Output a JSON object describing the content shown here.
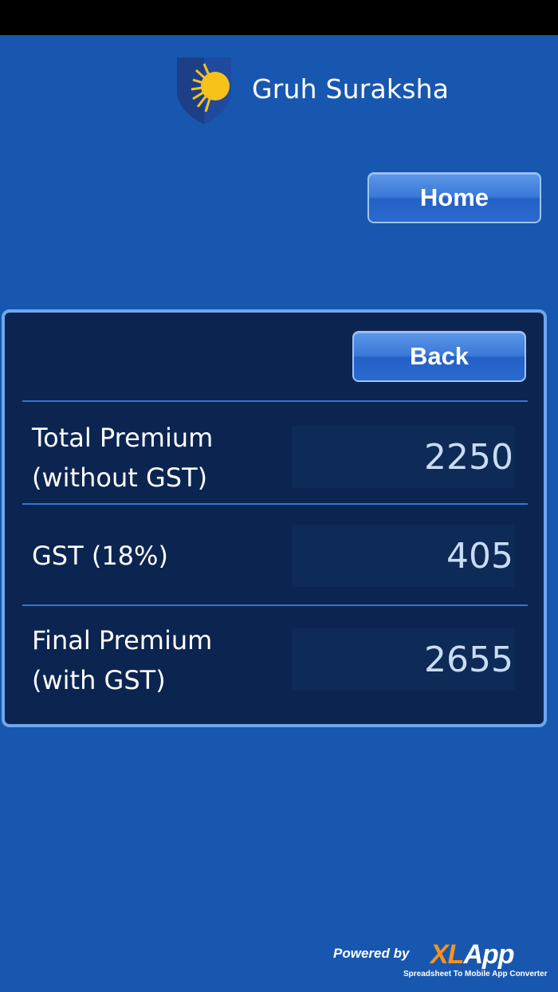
{
  "header": {
    "title": "Gruh Suraksha"
  },
  "nav": {
    "home_label": "Home",
    "back_label": "Back"
  },
  "premium": {
    "rows": [
      {
        "label_line1": "Total Premium",
        "label_line2": "(without GST)",
        "value": "2250"
      },
      {
        "label_line1": "GST (18%)",
        "value": "405"
      },
      {
        "label_line1": "Final Premium",
        "label_line2": "(with GST)",
        "value": "2655"
      }
    ]
  },
  "footer": {
    "powered_by": "Powered by",
    "brand_xl": "XL",
    "brand_app": "App",
    "tagline": "Spreadsheet To Mobile App Converter"
  },
  "colors": {
    "background": "#1857b0",
    "panel": "#0c2550",
    "button": "#3a78d8",
    "brand_orange": "#f7931e"
  }
}
